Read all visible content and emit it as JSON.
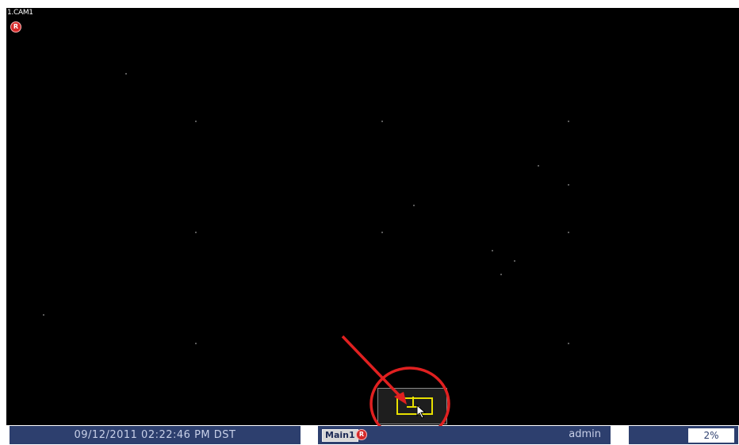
{
  "camera": {
    "label": "1.CAM1",
    "rec_badge": "R"
  },
  "status_bar": {
    "datetime": "09/12/2011 02:22:46 PM DST",
    "channel_label": "Main1",
    "rec_badge": "R",
    "user": "admin",
    "percent": "2%"
  },
  "colors": {
    "video_bg": "#000000",
    "status_bar": "#2d3f6e",
    "rec_red": "#d42a2a",
    "annotation_red": "#e02020",
    "icon_yellow": "#e8e000"
  },
  "icons": {
    "recording": "rec-icon",
    "popup": "sequence-icon",
    "cursor": "mouse-cursor-icon"
  },
  "annotation": {
    "type": "red circle with arrow pointing at popup button"
  }
}
